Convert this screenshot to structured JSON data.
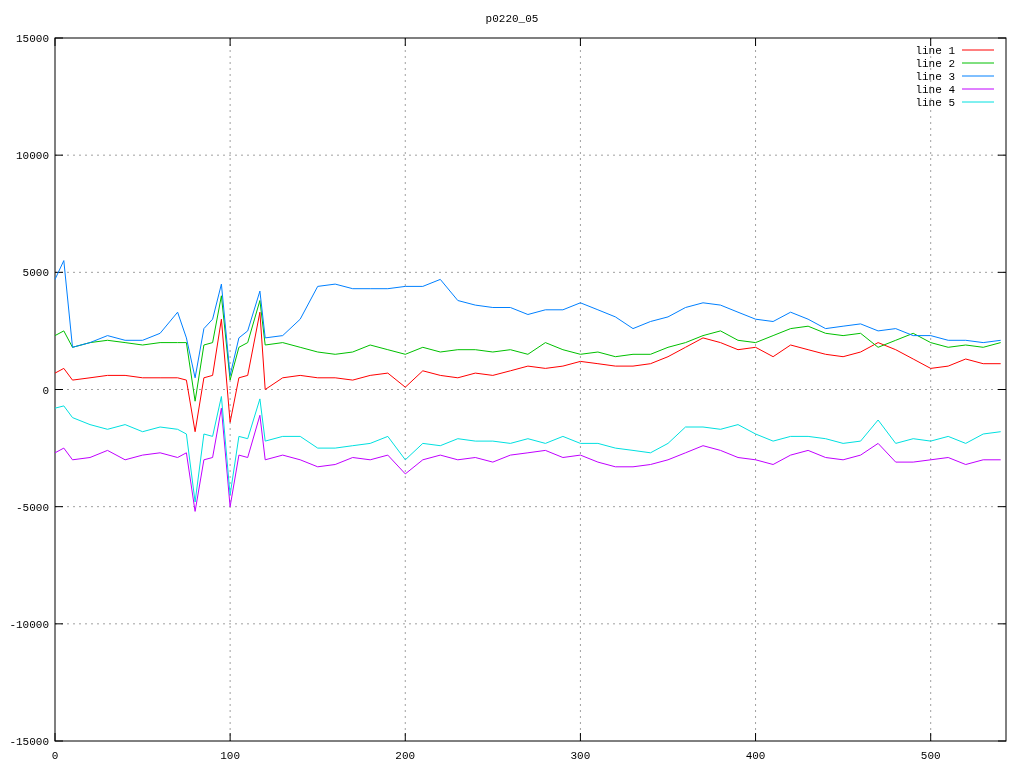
{
  "chart_data": {
    "type": "line",
    "title": "p0220_05",
    "x": [
      0,
      5,
      10,
      20,
      30,
      40,
      50,
      60,
      70,
      75,
      80,
      85,
      90,
      95,
      100,
      105,
      110,
      117,
      120,
      130,
      140,
      150,
      160,
      170,
      180,
      190,
      200,
      210,
      220,
      230,
      240,
      250,
      260,
      270,
      280,
      290,
      300,
      310,
      320,
      330,
      340,
      350,
      360,
      370,
      380,
      390,
      400,
      410,
      420,
      430,
      440,
      450,
      460,
      470,
      480,
      490,
      500,
      510,
      520,
      530,
      540
    ],
    "xlim": [
      0,
      543
    ],
    "ylim": [
      -15000,
      15000
    ],
    "xticks": [
      0,
      100,
      200,
      300,
      400,
      500
    ],
    "yticks": [
      -15000,
      -10000,
      -5000,
      0,
      5000,
      10000,
      15000
    ],
    "grid": true,
    "legend": true,
    "series": [
      {
        "name": "line 1",
        "color": "#ff0000",
        "values": [
          700,
          900,
          400,
          500,
          600,
          600,
          500,
          500,
          500,
          400,
          -1800,
          500,
          600,
          3000,
          -1400,
          500,
          600,
          3300,
          0,
          500,
          600,
          500,
          500,
          400,
          600,
          700,
          100,
          800,
          600,
          500,
          700,
          600,
          800,
          1000,
          900,
          1000,
          1200,
          1100,
          1000,
          1000,
          1100,
          1400,
          1800,
          2200,
          2000,
          1700,
          1800,
          1400,
          1900,
          1700,
          1500,
          1400,
          1600,
          2000,
          1700,
          1300,
          900,
          1000,
          1300,
          1100,
          1100
        ]
      },
      {
        "name": "line 2",
        "color": "#00c000",
        "values": [
          2300,
          2500,
          1800,
          2000,
          2100,
          2000,
          1900,
          2000,
          2000,
          2000,
          -500,
          1900,
          2000,
          4000,
          400,
          1800,
          2000,
          3800,
          1900,
          2000,
          1800,
          1600,
          1500,
          1600,
          1900,
          1700,
          1500,
          1800,
          1600,
          1700,
          1700,
          1600,
          1700,
          1500,
          2000,
          1700,
          1500,
          1600,
          1400,
          1500,
          1500,
          1800,
          2000,
          2300,
          2500,
          2100,
          2000,
          2300,
          2600,
          2700,
          2400,
          2300,
          2400,
          1800,
          2100,
          2400,
          2000,
          1800,
          1900,
          1800,
          2000
        ]
      },
      {
        "name": "line 3",
        "color": "#0080ff",
        "values": [
          4700,
          5500,
          1800,
          2000,
          2300,
          2100,
          2100,
          2400,
          3300,
          2200,
          500,
          2600,
          3000,
          4500,
          600,
          2200,
          2500,
          4200,
          2200,
          2300,
          3000,
          4400,
          4500,
          4300,
          4300,
          4300,
          4400,
          4400,
          4700,
          3800,
          3600,
          3500,
          3500,
          3200,
          3400,
          3400,
          3700,
          3400,
          3100,
          2600,
          2900,
          3100,
          3500,
          3700,
          3600,
          3300,
          3000,
          2900,
          3300,
          3000,
          2600,
          2700,
          2800,
          2500,
          2600,
          2300,
          2300,
          2100,
          2100,
          2000,
          2100
        ]
      },
      {
        "name": "line 4",
        "color": "#c000ff",
        "values": [
          -2700,
          -2500,
          -3000,
          -2900,
          -2600,
          -3000,
          -2800,
          -2700,
          -2900,
          -2700,
          -5200,
          -3000,
          -2900,
          -800,
          -5000,
          -2800,
          -2900,
          -1100,
          -3000,
          -2800,
          -3000,
          -3300,
          -3200,
          -2900,
          -3000,
          -2800,
          -3600,
          -3000,
          -2800,
          -3000,
          -2900,
          -3100,
          -2800,
          -2700,
          -2600,
          -2900,
          -2800,
          -3100,
          -3300,
          -3300,
          -3200,
          -3000,
          -2700,
          -2400,
          -2600,
          -2900,
          -3000,
          -3200,
          -2800,
          -2600,
          -2900,
          -3000,
          -2800,
          -2300,
          -3100,
          -3100,
          -3000,
          -2900,
          -3200,
          -3000,
          -3000
        ]
      },
      {
        "name": "line 5",
        "color": "#00e0e0",
        "values": [
          -800,
          -700,
          -1200,
          -1500,
          -1700,
          -1500,
          -1800,
          -1600,
          -1700,
          -1900,
          -4800,
          -1900,
          -2000,
          -300,
          -4500,
          -2000,
          -2100,
          -400,
          -2200,
          -2000,
          -2000,
          -2500,
          -2500,
          -2400,
          -2300,
          -2000,
          -3000,
          -2300,
          -2400,
          -2100,
          -2200,
          -2200,
          -2300,
          -2100,
          -2300,
          -2000,
          -2300,
          -2300,
          -2500,
          -2600,
          -2700,
          -2300,
          -1600,
          -1600,
          -1700,
          -1500,
          -1900,
          -2200,
          -2000,
          -2000,
          -2100,
          -2300,
          -2200,
          -1300,
          -2300,
          -2100,
          -2200,
          -2000,
          -2300,
          -1900,
          -1800
        ]
      }
    ]
  }
}
